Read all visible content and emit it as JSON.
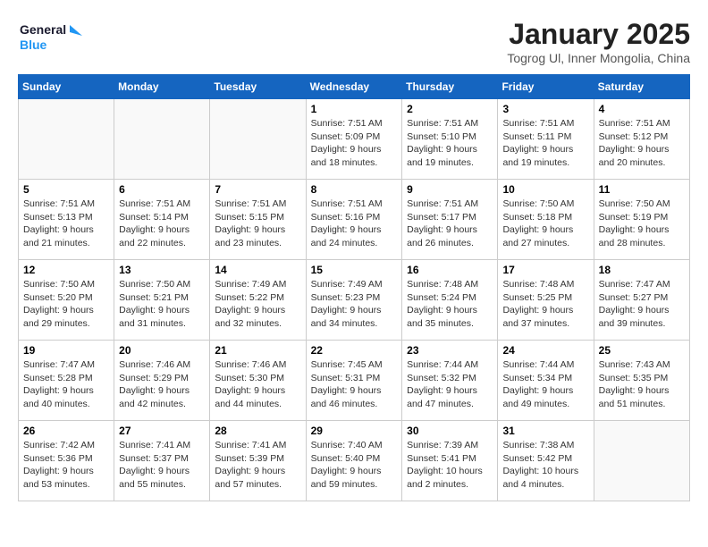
{
  "logo": {
    "line1": "General",
    "line2": "Blue"
  },
  "title": "January 2025",
  "location": "Togrog Ul, Inner Mongolia, China",
  "weekdays": [
    "Sunday",
    "Monday",
    "Tuesday",
    "Wednesday",
    "Thursday",
    "Friday",
    "Saturday"
  ],
  "weeks": [
    [
      {
        "day": "",
        "info": ""
      },
      {
        "day": "",
        "info": ""
      },
      {
        "day": "",
        "info": ""
      },
      {
        "day": "1",
        "info": "Sunrise: 7:51 AM\nSunset: 5:09 PM\nDaylight: 9 hours\nand 18 minutes."
      },
      {
        "day": "2",
        "info": "Sunrise: 7:51 AM\nSunset: 5:10 PM\nDaylight: 9 hours\nand 19 minutes."
      },
      {
        "day": "3",
        "info": "Sunrise: 7:51 AM\nSunset: 5:11 PM\nDaylight: 9 hours\nand 19 minutes."
      },
      {
        "day": "4",
        "info": "Sunrise: 7:51 AM\nSunset: 5:12 PM\nDaylight: 9 hours\nand 20 minutes."
      }
    ],
    [
      {
        "day": "5",
        "info": "Sunrise: 7:51 AM\nSunset: 5:13 PM\nDaylight: 9 hours\nand 21 minutes."
      },
      {
        "day": "6",
        "info": "Sunrise: 7:51 AM\nSunset: 5:14 PM\nDaylight: 9 hours\nand 22 minutes."
      },
      {
        "day": "7",
        "info": "Sunrise: 7:51 AM\nSunset: 5:15 PM\nDaylight: 9 hours\nand 23 minutes."
      },
      {
        "day": "8",
        "info": "Sunrise: 7:51 AM\nSunset: 5:16 PM\nDaylight: 9 hours\nand 24 minutes."
      },
      {
        "day": "9",
        "info": "Sunrise: 7:51 AM\nSunset: 5:17 PM\nDaylight: 9 hours\nand 26 minutes."
      },
      {
        "day": "10",
        "info": "Sunrise: 7:50 AM\nSunset: 5:18 PM\nDaylight: 9 hours\nand 27 minutes."
      },
      {
        "day": "11",
        "info": "Sunrise: 7:50 AM\nSunset: 5:19 PM\nDaylight: 9 hours\nand 28 minutes."
      }
    ],
    [
      {
        "day": "12",
        "info": "Sunrise: 7:50 AM\nSunset: 5:20 PM\nDaylight: 9 hours\nand 29 minutes."
      },
      {
        "day": "13",
        "info": "Sunrise: 7:50 AM\nSunset: 5:21 PM\nDaylight: 9 hours\nand 31 minutes."
      },
      {
        "day": "14",
        "info": "Sunrise: 7:49 AM\nSunset: 5:22 PM\nDaylight: 9 hours\nand 32 minutes."
      },
      {
        "day": "15",
        "info": "Sunrise: 7:49 AM\nSunset: 5:23 PM\nDaylight: 9 hours\nand 34 minutes."
      },
      {
        "day": "16",
        "info": "Sunrise: 7:48 AM\nSunset: 5:24 PM\nDaylight: 9 hours\nand 35 minutes."
      },
      {
        "day": "17",
        "info": "Sunrise: 7:48 AM\nSunset: 5:25 PM\nDaylight: 9 hours\nand 37 minutes."
      },
      {
        "day": "18",
        "info": "Sunrise: 7:47 AM\nSunset: 5:27 PM\nDaylight: 9 hours\nand 39 minutes."
      }
    ],
    [
      {
        "day": "19",
        "info": "Sunrise: 7:47 AM\nSunset: 5:28 PM\nDaylight: 9 hours\nand 40 minutes."
      },
      {
        "day": "20",
        "info": "Sunrise: 7:46 AM\nSunset: 5:29 PM\nDaylight: 9 hours\nand 42 minutes."
      },
      {
        "day": "21",
        "info": "Sunrise: 7:46 AM\nSunset: 5:30 PM\nDaylight: 9 hours\nand 44 minutes."
      },
      {
        "day": "22",
        "info": "Sunrise: 7:45 AM\nSunset: 5:31 PM\nDaylight: 9 hours\nand 46 minutes."
      },
      {
        "day": "23",
        "info": "Sunrise: 7:44 AM\nSunset: 5:32 PM\nDaylight: 9 hours\nand 47 minutes."
      },
      {
        "day": "24",
        "info": "Sunrise: 7:44 AM\nSunset: 5:34 PM\nDaylight: 9 hours\nand 49 minutes."
      },
      {
        "day": "25",
        "info": "Sunrise: 7:43 AM\nSunset: 5:35 PM\nDaylight: 9 hours\nand 51 minutes."
      }
    ],
    [
      {
        "day": "26",
        "info": "Sunrise: 7:42 AM\nSunset: 5:36 PM\nDaylight: 9 hours\nand 53 minutes."
      },
      {
        "day": "27",
        "info": "Sunrise: 7:41 AM\nSunset: 5:37 PM\nDaylight: 9 hours\nand 55 minutes."
      },
      {
        "day": "28",
        "info": "Sunrise: 7:41 AM\nSunset: 5:39 PM\nDaylight: 9 hours\nand 57 minutes."
      },
      {
        "day": "29",
        "info": "Sunrise: 7:40 AM\nSunset: 5:40 PM\nDaylight: 9 hours\nand 59 minutes."
      },
      {
        "day": "30",
        "info": "Sunrise: 7:39 AM\nSunset: 5:41 PM\nDaylight: 10 hours\nand 2 minutes."
      },
      {
        "day": "31",
        "info": "Sunrise: 7:38 AM\nSunset: 5:42 PM\nDaylight: 10 hours\nand 4 minutes."
      },
      {
        "day": "",
        "info": ""
      }
    ]
  ]
}
